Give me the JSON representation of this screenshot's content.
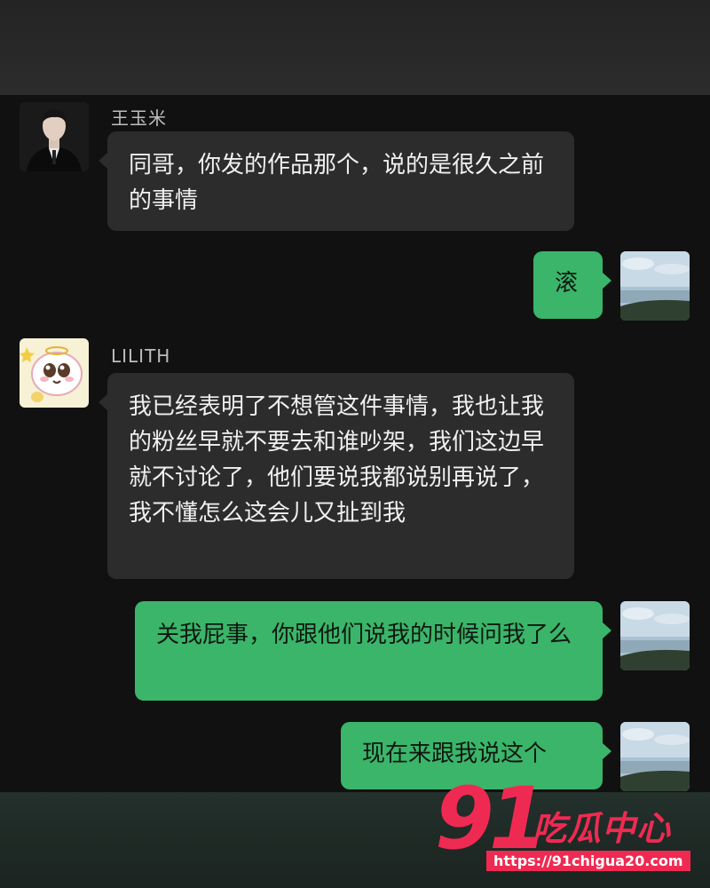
{
  "messages": [
    {
      "sender": "王玉米",
      "text": "同哥，你发的作品那个，说的是很久之前的事情"
    },
    {
      "text": "滚"
    },
    {
      "sender": "LILITH",
      "text": "我已经表明了不想管这件事情，我也让我的粉丝早就不要去和谁吵架，我们这边早就不讨论了，他们要说我都说别再说了，我不懂怎么这会儿又扯到我"
    },
    {
      "text": "关我屁事，你跟他们说我的时候问我了么"
    },
    {
      "text": "现在来跟我说这个"
    }
  ],
  "watermark": {
    "number": "91",
    "title": "吃瓜中心",
    "url": "https://91chigua20.com"
  }
}
